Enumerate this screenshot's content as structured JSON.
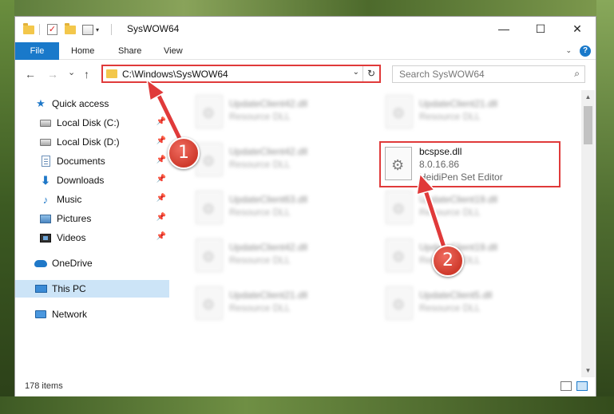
{
  "window": {
    "title": "SysWOW64",
    "minimize": "—",
    "maximize": "☐",
    "close": "✕"
  },
  "ribbon": {
    "file": "File",
    "tabs": [
      "Home",
      "Share",
      "View"
    ],
    "expand_icon": "chevron-down-icon",
    "help": "?"
  },
  "nav": {
    "back": "←",
    "forward": "→",
    "recent": "⌄",
    "up": "↑",
    "address": "C:\\Windows\\SysWOW64",
    "dropdown": "⌄",
    "refresh": "↻",
    "search_placeholder": "Search SysWOW64",
    "search_icon": "⌕"
  },
  "sidebar": {
    "items": [
      {
        "label": "Quick access",
        "icon": "star-icon"
      },
      {
        "label": "Local Disk (C:)",
        "icon": "disk-icon"
      },
      {
        "label": "Local Disk (D:)",
        "icon": "disk-icon"
      },
      {
        "label": "Documents",
        "icon": "documents-icon"
      },
      {
        "label": "Downloads",
        "icon": "download-icon"
      },
      {
        "label": "Music",
        "icon": "music-icon"
      },
      {
        "label": "Pictures",
        "icon": "pictures-icon"
      },
      {
        "label": "Videos",
        "icon": "videos-icon"
      },
      {
        "label": "OneDrive",
        "icon": "onedrive-icon"
      },
      {
        "label": "This PC",
        "icon": "pc-icon"
      },
      {
        "label": "Network",
        "icon": "network-icon"
      }
    ],
    "pin": "📌",
    "star": "★",
    "down": "⬇",
    "music": "♪"
  },
  "files": {
    "items": [
      {
        "name": "UpdateClient42.dll",
        "type": "Resource DLL"
      },
      {
        "name": "UpdateClient21.dll",
        "type": "Resource DLL"
      },
      {
        "name": "UpdateClient42.dll",
        "type": "Resource DLL"
      },
      {
        "name": "UpdateClient63.dll",
        "type": "Resource DLL"
      },
      {
        "name": "UpdateClient19.dll",
        "type": "Resource DLL"
      },
      {
        "name": "UpdateClient42.dll",
        "type": "Resource DLL"
      },
      {
        "name": "UpdateClient19.dll",
        "type": "Resource DLL"
      },
      {
        "name": "UpdateClient21.dll",
        "type": "Resource DLL"
      },
      {
        "name": "UpdateClient5.dll",
        "type": "Resource DLL"
      }
    ],
    "highlighted": {
      "name": "bcspse.dll",
      "version": "8.0.16.86",
      "description": "HeidiPen Set Editor"
    }
  },
  "status": {
    "count": "178 items"
  },
  "callouts": {
    "one": "1",
    "two": "2",
    "color": "#e03a3a"
  }
}
